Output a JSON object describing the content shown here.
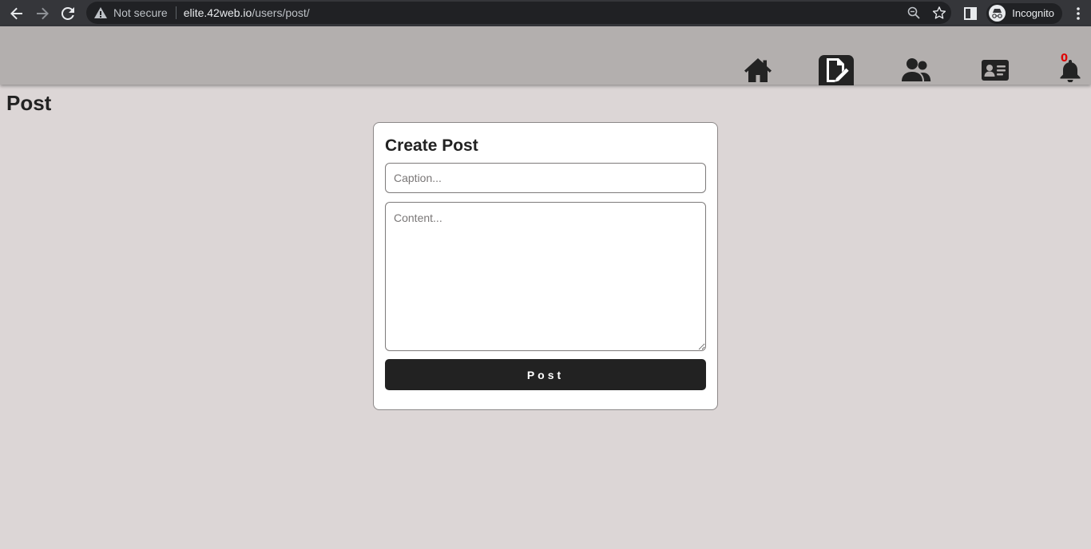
{
  "browser": {
    "security_label": "Not secure",
    "url_host": "elite.42web.io",
    "url_path": "/users/post/",
    "profile_label": "Incognito"
  },
  "header": {
    "nav": [
      {
        "icon": "home-icon"
      },
      {
        "icon": "edit-post-icon",
        "active": true
      },
      {
        "icon": "users-icon"
      },
      {
        "icon": "id-card-icon"
      },
      {
        "icon": "bell-icon"
      }
    ],
    "notification_count": "0"
  },
  "page": {
    "title": "Post"
  },
  "form": {
    "title": "Create Post",
    "caption_placeholder": "Caption...",
    "caption_value": "",
    "content_placeholder": "Content...",
    "content_value": "",
    "submit_label": "Post"
  },
  "colors": {
    "page_bg": "#dcd6d6",
    "header_bg": "#b3afae",
    "button_bg": "#222222",
    "badge": "#e00000"
  }
}
